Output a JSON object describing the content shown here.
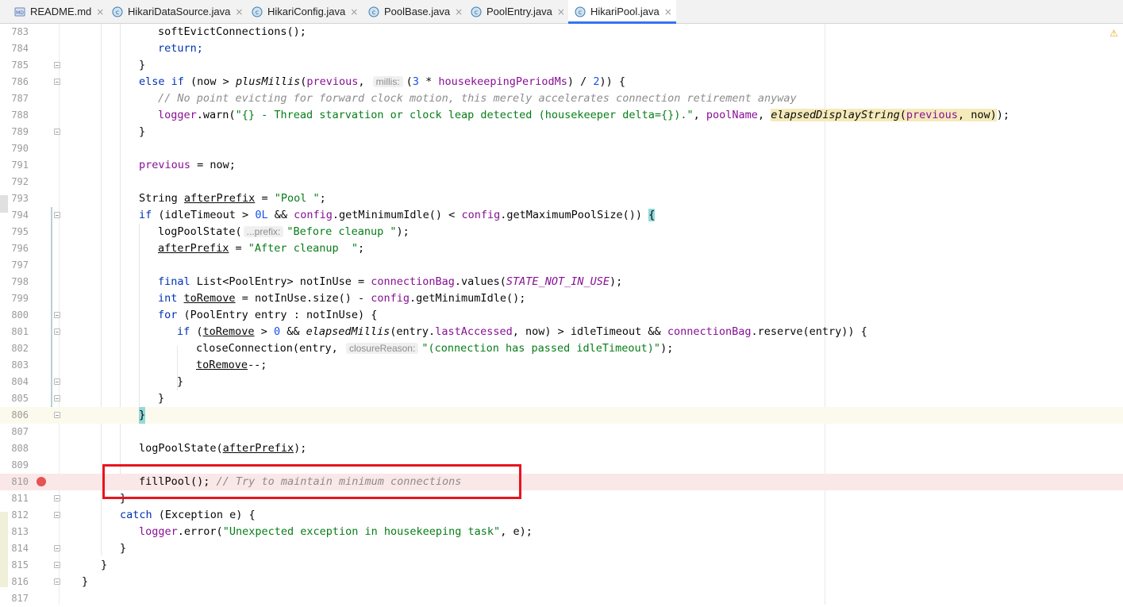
{
  "tabs": [
    {
      "label": "README.md",
      "icon": "markdown-file-icon",
      "active": false
    },
    {
      "label": "HikariDataSource.java",
      "icon": "java-class-icon",
      "active": false
    },
    {
      "label": "HikariConfig.java",
      "icon": "java-class-icon",
      "active": false
    },
    {
      "label": "PoolBase.java",
      "icon": "java-class-icon",
      "active": false
    },
    {
      "label": "PoolEntry.java",
      "icon": "java-class-icon",
      "active": false
    },
    {
      "label": "HikariPool.java",
      "icon": "java-class-icon",
      "active": true
    }
  ],
  "close_glyph": "×",
  "md_badge": "MD",
  "class_badge": "c",
  "warning_glyph": "⚠",
  "line_numbers": [
    "783",
    "784",
    "785",
    "786",
    "787",
    "788",
    "789",
    "790",
    "791",
    "792",
    "793",
    "794",
    "795",
    "796",
    "797",
    "798",
    "799",
    "800",
    "801",
    "802",
    "803",
    "804",
    "805",
    "806",
    "807",
    "808",
    "809",
    "810",
    "811",
    "812",
    "813",
    "814",
    "815",
    "816",
    "817"
  ],
  "code": {
    "l783": "softEvictConnections();",
    "l784": "return;",
    "l785": "}",
    "l786": [
      "else if",
      " (now > ",
      "plusMillis",
      "(",
      "previous",
      ", ",
      "millis:",
      "(",
      "3",
      " * ",
      "housekeepingPeriodMs",
      ") / ",
      "2",
      ")) {"
    ],
    "l787": "// No point evicting for forward clock motion, this merely accelerates connection retirement anyway",
    "l788": [
      "logger",
      ".warn(",
      "\"{} - Thread starvation or clock leap detected (housekeeper delta={}).\"",
      ", ",
      "poolName",
      ", ",
      "elapsedDisplayString",
      "(",
      "previous",
      ", now)",
      ");"
    ],
    "l789": "}",
    "l791": [
      "previous",
      " = now;"
    ],
    "l793": [
      "String ",
      "afterPrefix",
      " = ",
      "\"Pool \"",
      ";"
    ],
    "l794": [
      "if",
      " (idleTimeout > ",
      "0L",
      " && ",
      "config",
      ".getMinimumIdle() < ",
      "config",
      ".getMaximumPoolSize()) ",
      "{"
    ],
    "l795": [
      "logPoolState(",
      "...prefix:",
      "\"Before cleanup \"",
      ");"
    ],
    "l796": [
      "afterPrefix",
      " = ",
      "\"After cleanup  \"",
      ";"
    ],
    "l798": [
      "final",
      " List<PoolEntry> notInUse = ",
      "connectionBag",
      ".values(",
      "STATE_NOT_IN_USE",
      ");"
    ],
    "l799": [
      "int",
      " ",
      "toRemove",
      " = notInUse.size() - ",
      "config",
      ".getMinimumIdle();"
    ],
    "l800": [
      "for",
      " (PoolEntry entry : notInUse) {"
    ],
    "l801": [
      "if",
      " (",
      "toRemove",
      " > ",
      "0",
      " && ",
      "elapsedMillis",
      "(entry.",
      "lastAccessed",
      ", now) > idleTimeout && ",
      "connectionBag",
      ".reserve(entry)) {"
    ],
    "l802": [
      "closeConnection(entry, ",
      "closureReason:",
      "\"(connection has passed idleTimeout)\"",
      ");"
    ],
    "l803": [
      "toRemove",
      "--;"
    ],
    "l804": "}",
    "l805": "}",
    "l806": "}",
    "l808": [
      "logPoolState(",
      "afterPrefix",
      ");"
    ],
    "l810": [
      "fillPool(); ",
      "// Try to maintain minimum connections"
    ],
    "l811": "}",
    "l812": [
      "catch",
      " (Exception e) {"
    ],
    "l813": [
      "logger",
      ".error(",
      "\"Unexpected exception in housekeeping task\"",
      ", e);"
    ],
    "l814": "}",
    "l815": "}",
    "l816": "}"
  },
  "colors": {
    "keyword": "#0033b3",
    "string": "#067d17",
    "comment": "#8c8c8c",
    "field": "#871094",
    "number": "#1750eb",
    "breakpoint": "#e55353",
    "annotation_box": "#e8141e",
    "active_tab_underline": "#3574f0"
  }
}
